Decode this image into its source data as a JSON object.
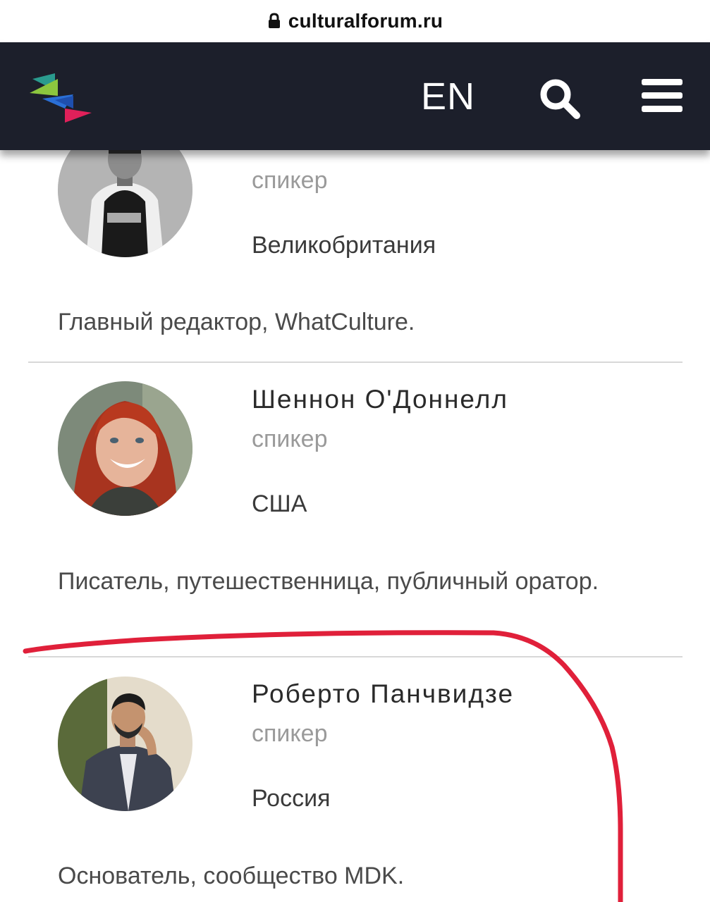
{
  "browser": {
    "url": "culturalforum.ru"
  },
  "header": {
    "language": "EN"
  },
  "speakers": [
    {
      "role": "спикер",
      "country": "Великобритания",
      "description": "Главный редактор, WhatCulture."
    },
    {
      "name": "Шеннон О'Доннелл",
      "role": "спикер",
      "country": "США",
      "description": "Писатель, путешественница, публичный оратор."
    },
    {
      "name": "Роберто Панчвидзе",
      "role": "спикер",
      "country": "Россия",
      "description": "Основатель, сообщество MDK."
    }
  ],
  "colors": {
    "header_bg": "#1c1f2b",
    "annotation": "#e0203a"
  },
  "icons": [
    "lock-icon",
    "site-logo",
    "search-icon",
    "menu-icon"
  ]
}
